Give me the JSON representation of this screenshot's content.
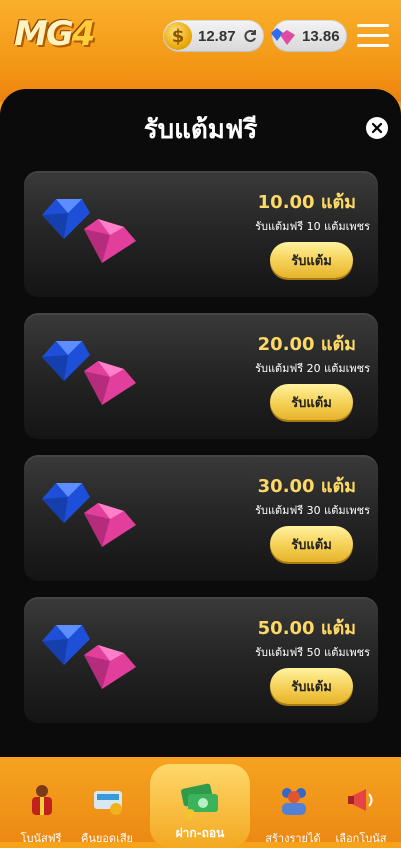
{
  "header": {
    "logo_text": "MG4",
    "coin_balance": "12.87",
    "gem_balance": "13.86"
  },
  "modal": {
    "title": "รับแต้มฟรี",
    "cards": [
      {
        "points": "10.00 แต้ม",
        "desc": "รับแต้มฟรี 10 แต้มเพชร",
        "button": "รับแต้ม"
      },
      {
        "points": "20.00 แต้ม",
        "desc": "รับแต้มฟรี 20 แต้มเพชร",
        "button": "รับแต้ม"
      },
      {
        "points": "30.00 แต้ม",
        "desc": "รับแต้มฟรี 30 แต้มเพชร",
        "button": "รับแต้ม"
      },
      {
        "points": "50.00 แต้ม",
        "desc": "รับแต้มฟรี 50 แต้มเพชร",
        "button": "รับแต้ม"
      }
    ]
  },
  "bottom_nav": [
    {
      "label": "โบนัสฟรี",
      "icon": "gift-person-icon"
    },
    {
      "label": "คืนยอดเสีย",
      "icon": "cashback-icon"
    },
    {
      "label": "ฝาก-ถอน",
      "icon": "money-icon"
    },
    {
      "label": "สร้างรายได้",
      "icon": "people-icon"
    },
    {
      "label": "เลือกโบนัส",
      "icon": "megaphone-icon"
    }
  ],
  "colors": {
    "accent_orange": "#f39415",
    "gold_text": "#ffd966",
    "button_gold": "#f6d35a",
    "modal_bg": "#0b0b0b"
  }
}
